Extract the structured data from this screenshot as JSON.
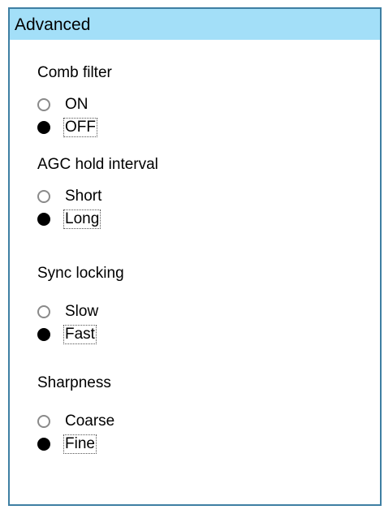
{
  "panel": {
    "title": "Advanced",
    "title_bg": "#a3dff8",
    "border_color": "#3e7fa3"
  },
  "groups": [
    {
      "label": "Comb filter",
      "options": [
        "ON",
        "OFF"
      ],
      "selected": "OFF"
    },
    {
      "label": "AGC hold interval",
      "options": [
        "Short",
        "Long"
      ],
      "selected": "Long"
    },
    {
      "label": "Sync locking",
      "options": [
        "Slow",
        "Fast"
      ],
      "selected": "Fast"
    },
    {
      "label": "Sharpness",
      "options": [
        "Coarse",
        "Fine"
      ],
      "selected": "Fine"
    }
  ]
}
